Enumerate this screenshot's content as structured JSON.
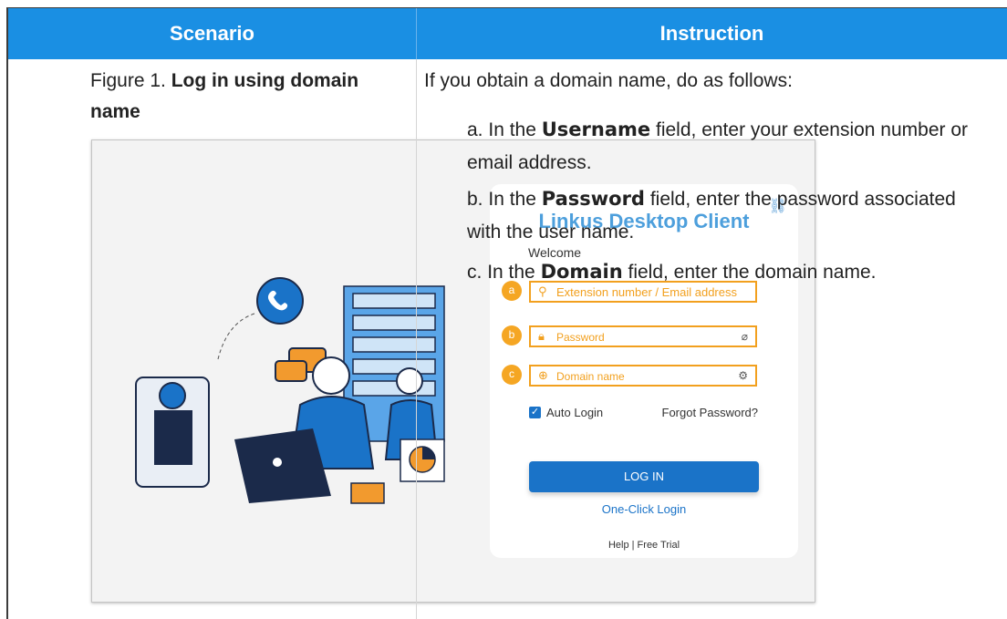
{
  "header": {
    "scenario": "Scenario",
    "instruction": "Instruction"
  },
  "figure": {
    "caption_prefix": "Figure 1.",
    "caption_title": "Log in using domain name"
  },
  "instructions": {
    "intro": "If you obtain a domain name, do as follows:",
    "steps": [
      {
        "marker": "a.",
        "pre": "In the",
        "field": "Username",
        "post": "field, enter your extension number or email address."
      },
      {
        "marker": "b.",
        "pre": "In the",
        "field": "Password",
        "post": "field, enter the password associated with the user name."
      },
      {
        "marker": "c.",
        "pre": "In the",
        "field": "Domain",
        "post": "field, enter the domain name."
      }
    ]
  },
  "login_screen": {
    "title": "Linkus Desktop Client",
    "welcome": "Welcome",
    "fields": [
      {
        "badge": "a",
        "placeholder": "Extension number / Email address",
        "icon": "user-icon"
      },
      {
        "badge": "b",
        "placeholder": "Password",
        "icon": "lock-icon",
        "trailing_icon": "eye-off-icon"
      },
      {
        "badge": "c",
        "placeholder": "Domain name",
        "icon": "globe-icon",
        "trailing_icon": "settings-icon"
      }
    ],
    "auto_login": "Auto Login",
    "forgot_password": "Forgot Password?",
    "login_button": "LOG IN",
    "one_click": "One-Click Login",
    "footer": "Help | Free Trial"
  },
  "colors": {
    "header_bg": "#1a8fe3",
    "accent": "#1a73c8",
    "highlight": "#f2a01e"
  }
}
